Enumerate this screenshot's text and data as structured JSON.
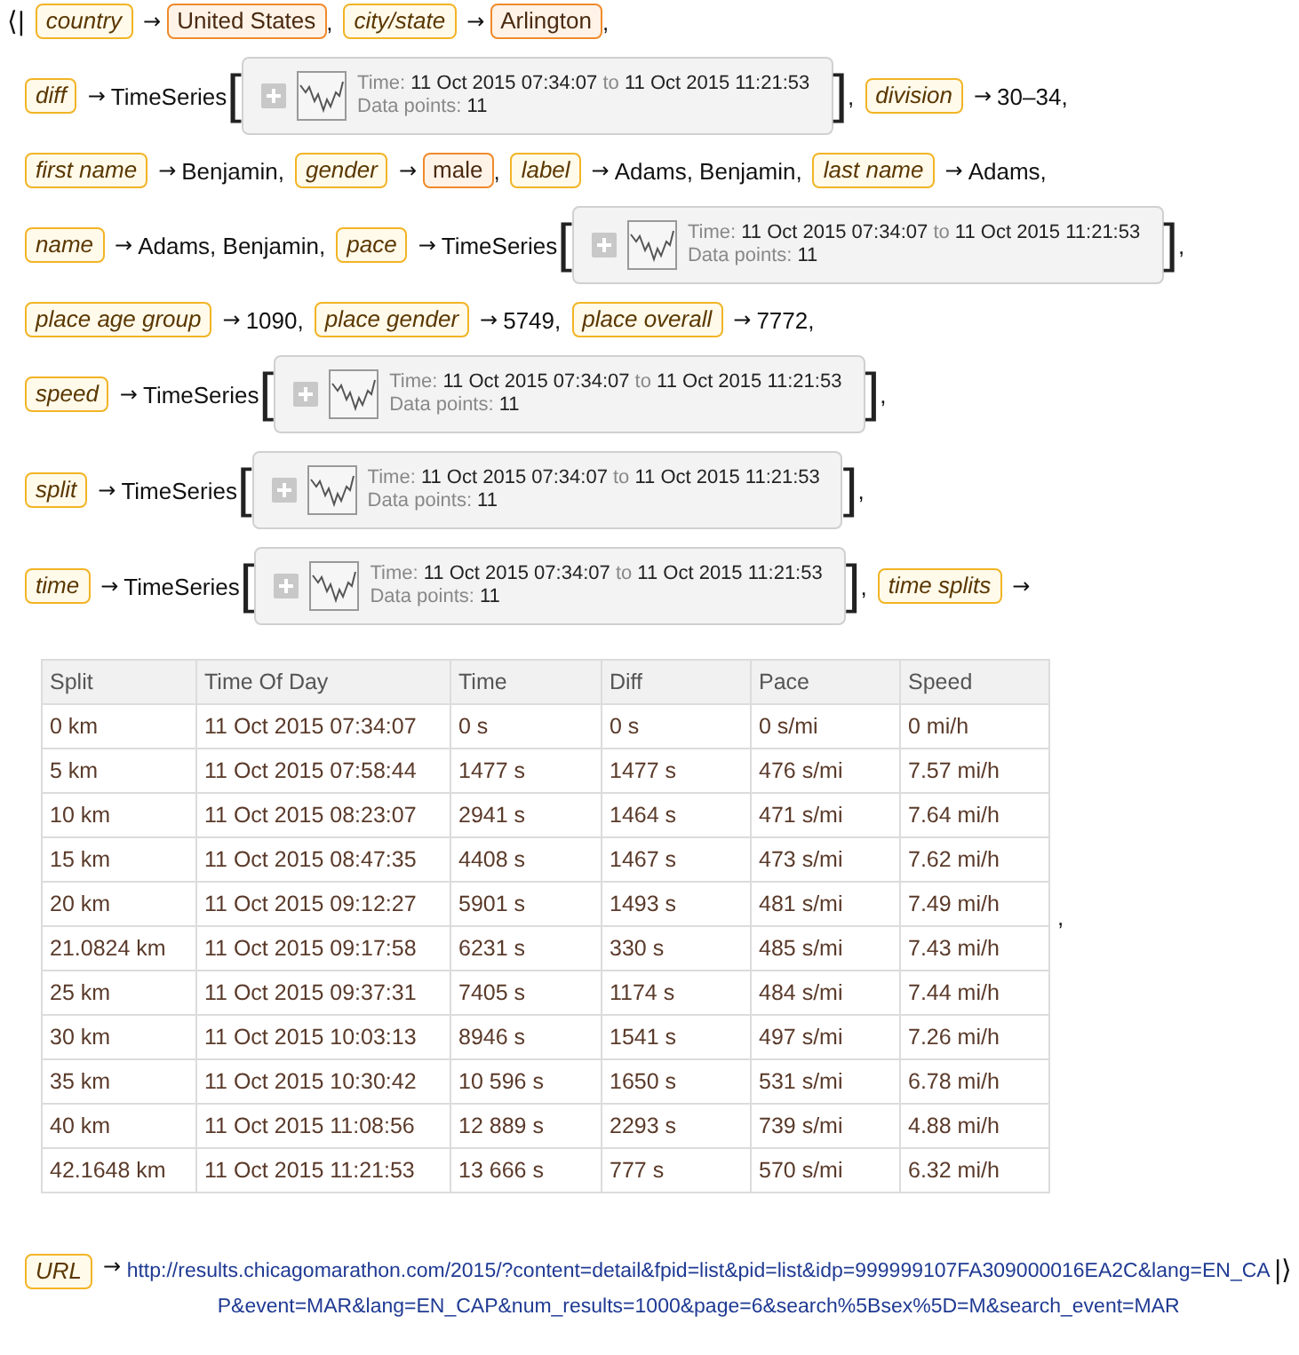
{
  "association": {
    "open": "⟨|",
    "close": "|⟩",
    "lines": [
      {
        "kind": "entries",
        "entries": [
          {
            "key": "country",
            "arrow": "→",
            "value": {
              "kind": "entity",
              "text": "United States"
            },
            "sep": ","
          },
          {
            "key": "city/state",
            "arrow": "→",
            "value": {
              "kind": "entity",
              "text": "Arlington"
            },
            "sep": ","
          }
        ]
      },
      {
        "kind": "entries",
        "entries": [
          {
            "key": "diff",
            "arrow": "→",
            "value": {
              "kind": "timeseries",
              "head": "TimeSeries",
              "open": "[",
              "time_label": "Time:",
              "start": "11 Oct 2015 07:34:07",
              "to": "to",
              "end": "11 Oct 2015 11:21:53",
              "points_label": "Data points:",
              "points": "11",
              "close": "]"
            },
            "sep": ","
          },
          {
            "key": "division",
            "arrow": "→",
            "value": {
              "kind": "text",
              "text": "30–34"
            },
            "sep": ","
          }
        ]
      },
      {
        "kind": "entries",
        "entries": [
          {
            "key": "first name",
            "arrow": "→",
            "value": {
              "kind": "text",
              "text": "Benjamin"
            },
            "sep": ","
          },
          {
            "key": "gender",
            "arrow": "→",
            "value": {
              "kind": "entity",
              "text": "male"
            },
            "sep": ","
          },
          {
            "key": "label",
            "arrow": "→",
            "value": {
              "kind": "text",
              "text": "Adams, Benjamin"
            },
            "sep": ","
          },
          {
            "key": "last name",
            "arrow": "→",
            "value": {
              "kind": "text",
              "text": "Adams"
            },
            "sep": ","
          }
        ]
      },
      {
        "kind": "entries",
        "entries": [
          {
            "key": "name",
            "arrow": "→",
            "value": {
              "kind": "text",
              "text": "Adams, Benjamin"
            },
            "sep": ","
          },
          {
            "key": "pace",
            "arrow": "→",
            "value": {
              "kind": "timeseries",
              "head": "TimeSeries",
              "open": "[",
              "time_label": "Time:",
              "start": "11 Oct 2015 07:34:07",
              "to": "to",
              "end": "11 Oct 2015 11:21:53",
              "points_label": "Data points:",
              "points": "11",
              "close": "]"
            },
            "sep": ","
          }
        ]
      },
      {
        "kind": "entries",
        "entries": [
          {
            "key": "place age group",
            "arrow": "→",
            "value": {
              "kind": "text",
              "text": "1090"
            },
            "sep": ","
          },
          {
            "key": "place gender",
            "arrow": "→",
            "value": {
              "kind": "text",
              "text": "5749"
            },
            "sep": ","
          },
          {
            "key": "place overall",
            "arrow": "→",
            "value": {
              "kind": "text",
              "text": "7772"
            },
            "sep": ","
          }
        ]
      },
      {
        "kind": "entries",
        "entries": [
          {
            "key": "speed",
            "arrow": "→",
            "value": {
              "kind": "timeseries",
              "head": "TimeSeries",
              "open": "[",
              "time_label": "Time:",
              "start": "11 Oct 2015 07:34:07",
              "to": "to",
              "end": "11 Oct 2015 11:21:53",
              "points_label": "Data points:",
              "points": "11",
              "close": "]"
            },
            "sep": ","
          }
        ]
      },
      {
        "kind": "entries",
        "entries": [
          {
            "key": "split",
            "arrow": "→",
            "value": {
              "kind": "timeseries",
              "head": "TimeSeries",
              "open": "[",
              "time_label": "Time:",
              "start": "11 Oct 2015 07:34:07",
              "to": "to",
              "end": "11 Oct 2015 11:21:53",
              "points_label": "Data points:",
              "points": "11",
              "close": "]"
            },
            "sep": ","
          }
        ]
      },
      {
        "kind": "entries",
        "entries": [
          {
            "key": "time",
            "arrow": "→",
            "value": {
              "kind": "timeseries",
              "head": "TimeSeries",
              "open": "[",
              "time_label": "Time:",
              "start": "11 Oct 2015 07:34:07",
              "to": "to",
              "end": "11 Oct 2015 11:21:53",
              "points_label": "Data points:",
              "points": "11",
              "close": "]"
            },
            "sep": ","
          },
          {
            "key": "time splits",
            "arrow": "→"
          }
        ]
      },
      {
        "kind": "table",
        "sep": ",",
        "columns": [
          "Split",
          "Time Of Day",
          "Time",
          "Diff",
          "Pace",
          "Speed"
        ],
        "rows": [
          [
            "0 km",
            "11 Oct 2015 07:34:07",
            "0 s",
            "0 s",
            "0 s/mi",
            "0 mi/h"
          ],
          [
            "5 km",
            "11 Oct 2015 07:58:44",
            "1477 s",
            "1477 s",
            "476 s/mi",
            "7.57 mi/h"
          ],
          [
            "10 km",
            "11 Oct 2015 08:23:07",
            "2941 s",
            "1464 s",
            "471 s/mi",
            "7.64 mi/h"
          ],
          [
            "15 km",
            "11 Oct 2015 08:47:35",
            "4408 s",
            "1467 s",
            "473 s/mi",
            "7.62 mi/h"
          ],
          [
            "20 km",
            "11 Oct 2015 09:12:27",
            "5901 s",
            "1493 s",
            "481 s/mi",
            "7.49 mi/h"
          ],
          [
            "21.0824 km",
            "11 Oct 2015 09:17:58",
            "6231 s",
            "330 s",
            "485 s/mi",
            "7.43 mi/h"
          ],
          [
            "25 km",
            "11 Oct 2015 09:37:31",
            "7405 s",
            "1174 s",
            "484 s/mi",
            "7.44 mi/h"
          ],
          [
            "30 km",
            "11 Oct 2015 10:03:13",
            "8946 s",
            "1541 s",
            "497 s/mi",
            "7.26 mi/h"
          ],
          [
            "35 km",
            "11 Oct 2015 10:30:42",
            "10 596 s",
            "1650 s",
            "531 s/mi",
            "6.78 mi/h"
          ],
          [
            "40 km",
            "11 Oct 2015 11:08:56",
            "12 889 s",
            "2293 s",
            "739 s/mi",
            "4.88 mi/h"
          ],
          [
            "42.1648 km",
            "11 Oct 2015 11:21:53",
            "13 666 s",
            "777 s",
            "570 s/mi",
            "6.32 mi/h"
          ]
        ]
      },
      {
        "kind": "entries",
        "entries": [
          {
            "key": "URL",
            "arrow": "→",
            "value": {
              "kind": "link",
              "text": "http://results.chicagomarathon.com/2015/?content=detail&fpid=list&pid=list&idp=999999107FA309000016EA2C&lang=EN_CAP&event=MAR&lang=EN_CAP&num_results=1000&page=6&search%5Bsex%5D=M&search_event=MAR"
            }
          }
        ]
      }
    ]
  }
}
